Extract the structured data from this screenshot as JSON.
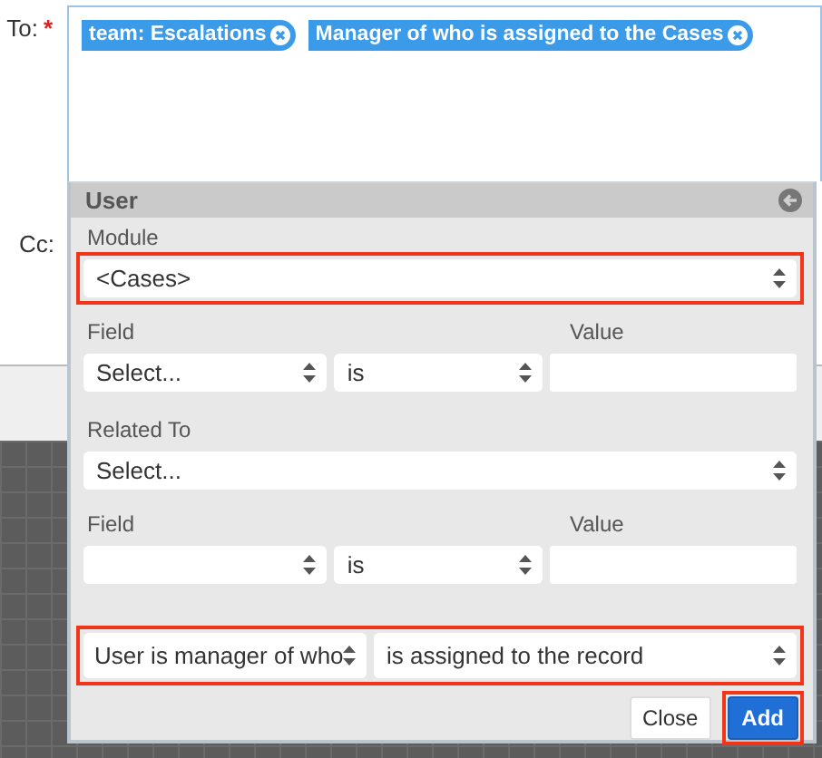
{
  "to": {
    "label": "To:",
    "required_mark": "*",
    "recipients": [
      {
        "label": "team: Escalations"
      },
      {
        "label": "Manager of who is assigned to the Cases"
      }
    ]
  },
  "cc": {
    "label": "Cc:"
  },
  "panel": {
    "title": "User",
    "rows": [
      {
        "kind": "select",
        "label": "Module",
        "value": "<Cases>",
        "highlighted": true
      },
      {
        "kind": "condition",
        "field_label": "Field",
        "value_label": "Value",
        "field": "Select...",
        "operator": "is",
        "highlighted": false
      },
      {
        "kind": "select",
        "label": "Related To",
        "value": "Select...",
        "highlighted": false
      },
      {
        "kind": "condition",
        "field_label": "Field",
        "value_label": "Value",
        "operator": "is",
        "highlighted": false
      },
      {
        "kind": "pair",
        "first": "User is manager of who",
        "second": "is assigned to the record",
        "highlighted": true
      }
    ],
    "buttons": [
      {
        "label": "Close",
        "kind": "secondary",
        "highlighted": false
      },
      {
        "label": "Add",
        "kind": "primary",
        "highlighted": true
      }
    ]
  }
}
